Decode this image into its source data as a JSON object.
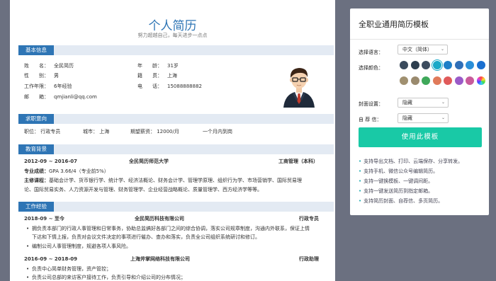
{
  "resume": {
    "title": "个人简历",
    "subtitle": "努力超越自己，每天进步一点点",
    "sections": {
      "basic": "基本信息",
      "intent": "求职意向",
      "education": "教育背景",
      "work": "工作经验"
    },
    "basic": {
      "name_label": "姓　　名：",
      "name_value": "全民简历",
      "gender_label": "性　　别：",
      "gender_value": "男",
      "years_label": "工作年限：",
      "years_value": "6年经验",
      "email_label": "邮　　箱：",
      "email_value": "qmjianli@qq.com",
      "age_label": "年　　龄：",
      "age_value": "31岁",
      "origin_label": "籍　　贯：",
      "origin_value": "上海",
      "phone_label": "电　　话：",
      "phone_value": "15088888882"
    },
    "intent": {
      "position": "职位：  行政专员",
      "city": "城市：  上海",
      "salary": "期望薪资：  12000/月",
      "start": "一个月内到岗"
    },
    "education": {
      "period": "2012-09 ~ 2016-07",
      "school": "全民简历师范大学",
      "major": "工商管理（本科）",
      "gpa_label": "专业成绩：",
      "gpa_value": "GPA 3.66/4（专业前5%）",
      "courses_label": "主修课程：",
      "courses_line1": "基础会计学、货币银行学、统计学、经济法概论、财务会计学、管理学原理、组织行为学、市场营销学、国际贸易理",
      "courses_line2": "论、国际贸易实务、人力资源开发与管理、财务管理学、企业经营战略概论、质量管理学、西方经济学等等。"
    },
    "work": [
      {
        "period": "2018-09 ~ 至今",
        "company": "全民简历科技有限公司",
        "role": "行政专员",
        "bullets": [
          "拥负责本部门的行政人事管理和日常事务，协助总监搞好各部门之间的综合协调，落实公司规章制度，沟通内外联系，保证上情",
          "下达和下情上报，负责对会议文件决定的事项进行催办、查办和落实，负责全公司组织系统研讨和修订。",
          "编制公司人事管理制度，规避各项人事风险。"
        ]
      },
      {
        "period": "2016-09 ~ 2018-09",
        "company": "上海斧掌网络科技有限公司",
        "role": "行政助理",
        "bullets": [
          "负责中心简单财务管理，资产管控；",
          "负责公司总部的来访客户接待工作，负责引导和介绍公司的分布情况；"
        ]
      }
    ]
  },
  "panel": {
    "title": "全职业通用简历模板",
    "language_label": "选择语言：",
    "language_value": "中文（简体）",
    "color_label": "选择颜色：",
    "cover_label": "封面设置：",
    "cover_value": "隐藏",
    "selfletter_label": "自 荐 信：",
    "selfletter_value": "隐藏",
    "use_button": "使用此模板",
    "features": [
      "支持导出文档、打印、云端保存、分享转发。",
      "支持手机、微信公众号编辑简历。",
      "支持一键换模板、一键调间距。",
      "支持一键发送简历到指定邮箱。",
      "支持简历封面、自荐信、多页简历。"
    ],
    "colors_row1": [
      "#3a4a5c",
      "#2d3e4e",
      "#3c4c5e",
      "#1aa9c8",
      "#1e7fc8",
      "#2f6fb8",
      "#2b8fd8",
      "#1a6fd0"
    ],
    "colors_row2": [
      "#a09070",
      "#9a8a6e",
      "#3fa85a",
      "#e07a5a",
      "#e05a5a",
      "#9a5ac8",
      "#c85a9a",
      "#f0b030"
    ],
    "selected_color_index": 3
  }
}
